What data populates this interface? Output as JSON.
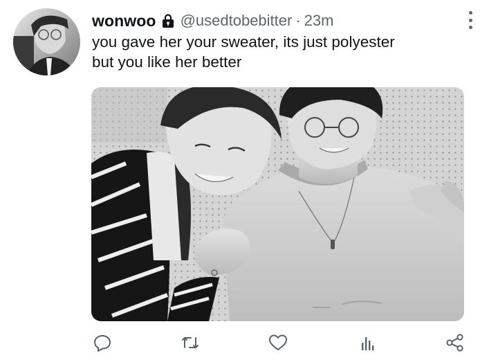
{
  "tweet": {
    "display_name": "wonwoo",
    "protected_icon": "lock-icon",
    "handle": "@usedtobebitter",
    "separator": "·",
    "timestamp": "23m",
    "text_lines": [
      "you gave her your sweater, its just polyester",
      "but you like her better"
    ]
  },
  "media": {
    "type": "photo",
    "style": "black-and-white"
  },
  "actions": [
    {
      "icon": "reply-icon"
    },
    {
      "icon": "retweet-icon"
    },
    {
      "icon": "like-icon"
    },
    {
      "icon": "analytics-icon"
    },
    {
      "icon": "share-icon"
    }
  ],
  "colors": {
    "text": "#0f1419",
    "secondary": "#5b6670",
    "icon": "#536471"
  }
}
